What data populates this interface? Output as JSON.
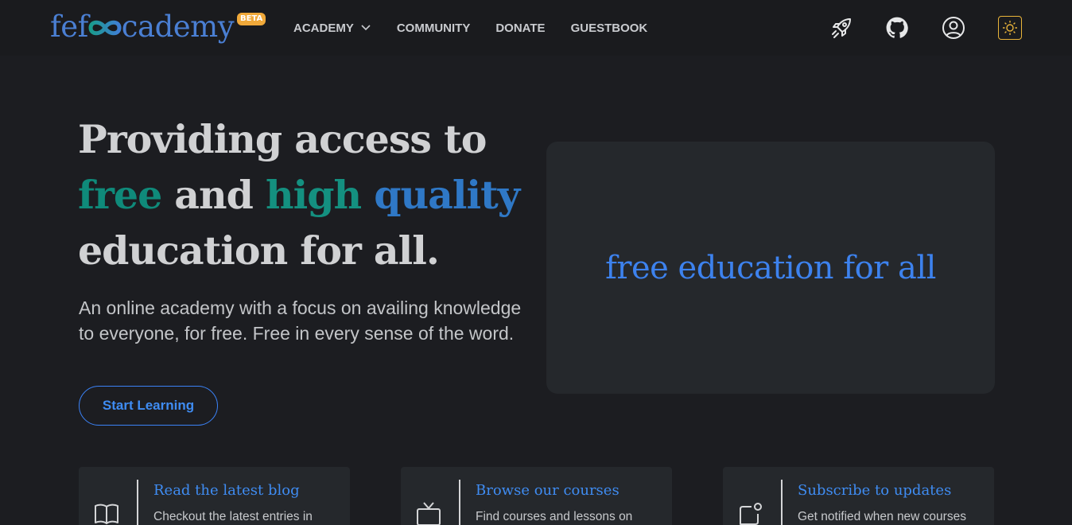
{
  "header": {
    "logo": {
      "prefix": "fef",
      "suffix": "cademy",
      "badge": "BETA"
    },
    "nav": [
      {
        "label": "ACADEMY",
        "has_dropdown": true
      },
      {
        "label": "COMMUNITY"
      },
      {
        "label": "DONATE"
      },
      {
        "label": "GUESTBOOK"
      }
    ],
    "icons": [
      "rocket-icon",
      "github-icon",
      "user-icon",
      "sun-icon"
    ]
  },
  "hero": {
    "title_line1": "Providing access to",
    "title_free": "free",
    "title_and": " and ",
    "title_high": "high",
    "title_quality": "quality",
    "title_line3": "education for all.",
    "description": "An online academy with a focus on availing knowledge to everyone, for free. Free in every sense of the word.",
    "cta_label": "Start Learning",
    "card_text": "free education for all"
  },
  "features": [
    {
      "icon": "book-icon",
      "title": "Read the latest blog",
      "desc": "Checkout the latest entries in"
    },
    {
      "icon": "tv-icon",
      "title": "Browse our courses",
      "desc": "Find courses and lessons on"
    },
    {
      "icon": "notification-icon",
      "title": "Subscribe to updates",
      "desc": "Get notified when new courses"
    }
  ],
  "colors": {
    "background": "#1c1d21",
    "accent_blue": "#3f8cf2",
    "accent_teal": "#0f8a7a",
    "theme_toggle": "#e9b43a",
    "beta_badge": "#f0a93a"
  }
}
